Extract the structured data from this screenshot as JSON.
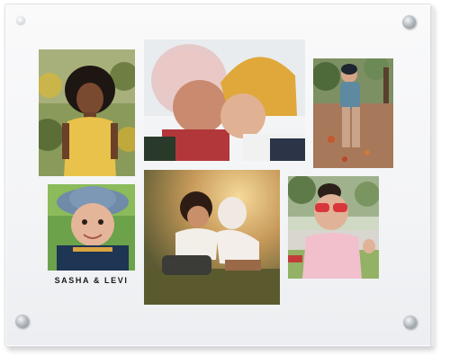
{
  "product": {
    "caption": "SASHA & LEVI"
  },
  "photos": [
    {
      "subject": "girl-yellow-dress"
    },
    {
      "subject": "two-children-knit-hats"
    },
    {
      "subject": "child-autumn-leaves"
    },
    {
      "subject": "toddler-bucket-hat"
    },
    {
      "subject": "children-hugging-sunset"
    },
    {
      "subject": "girl-red-sunglasses"
    }
  ],
  "colors": {
    "acrylic": "#f3f4f6",
    "hardware": "#9aa1a8",
    "caption_text": "#1a1a1a"
  }
}
